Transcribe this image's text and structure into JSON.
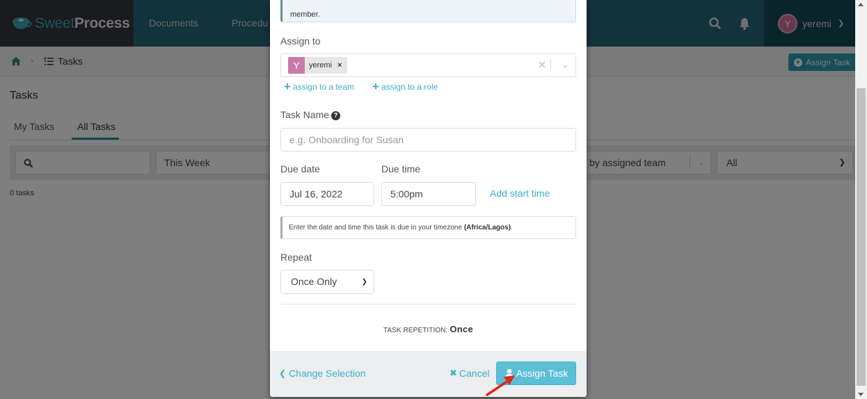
{
  "app": {
    "logo_sweet": "Sweet",
    "logo_process": "Process",
    "nav": [
      "Documents",
      "Procedu"
    ],
    "user": {
      "initial": "Y",
      "name": "yeremi"
    }
  },
  "breadcrumb": {
    "current": "Tasks"
  },
  "header": {
    "assign_task_label": "Assign Task"
  },
  "page": {
    "title": "Tasks",
    "tabs": [
      {
        "label": "My Tasks",
        "active": false
      },
      {
        "label": "All Tasks",
        "active": true
      }
    ],
    "filters": {
      "period": "This Week",
      "team_placeholder": "Filter by assigned team",
      "status": "All"
    },
    "count_text": "0 tasks"
  },
  "modal": {
    "info_text_tail": "member.",
    "assign_to_label": "Assign to",
    "assignee": {
      "initial": "Y",
      "name": "yeremi",
      "remove": "×"
    },
    "assign_team_link": "assign to a team",
    "assign_role_link": "assign to a role",
    "task_name_label": "Task Name",
    "task_name_placeholder": "e.g. Onboarding for Susan",
    "due_date_label": "Due date",
    "due_date_value": "Jul 16, 2022",
    "due_time_label": "Due time",
    "due_time_value": "5:00pm",
    "add_start_time": "Add start time",
    "tz_text": "Enter the date and time this task is due in your timezone",
    "tz_name": "(Africa/Lagos)",
    "repeat_label": "Repeat",
    "repeat_value": "Once Only",
    "repetition_label": "TASK REPETITION:",
    "repetition_value": "Once",
    "change_selection": "Change Selection",
    "cancel": "Cancel",
    "assign_task": "Assign Task"
  },
  "colors": {
    "accent": "#3ab0c8",
    "primary_button": "#5bbfd6",
    "nav_bg": "#256674",
    "annotation_arrow": "#e0261c"
  }
}
